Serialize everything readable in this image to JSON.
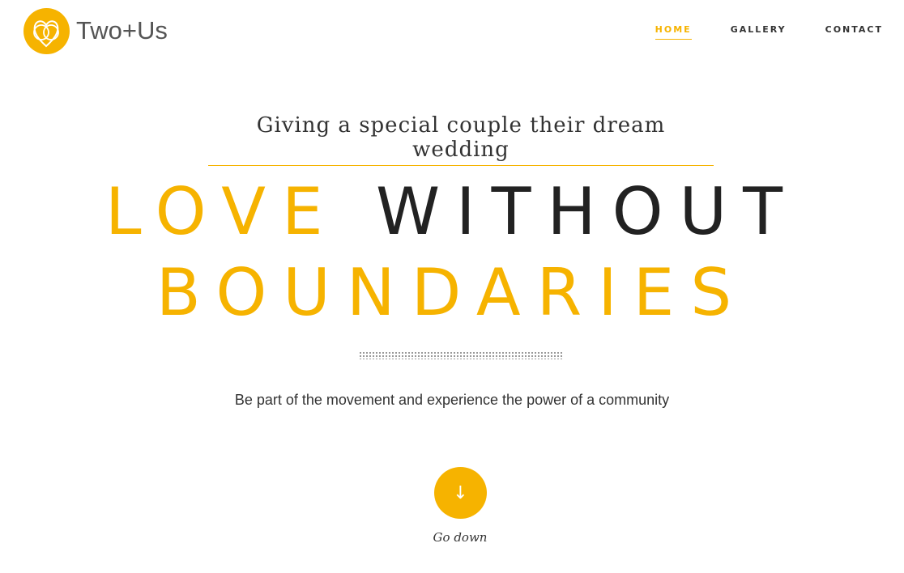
{
  "brand": {
    "name": "Two+Us",
    "accent": "#f6b300"
  },
  "nav": {
    "items": [
      "HOME",
      "GALLERY",
      "CONTACT"
    ],
    "active": "HOME"
  },
  "hero": {
    "tagline": "Giving a special couple their dream wedding",
    "headline_word1": "LOVE",
    "headline_word2": "WITHOUT",
    "headline_word3": "BOUNDARIES",
    "subtitle": "Be part of the movement and experience the power of a community"
  },
  "scroll": {
    "arrow": "↓",
    "label": "Go down"
  }
}
